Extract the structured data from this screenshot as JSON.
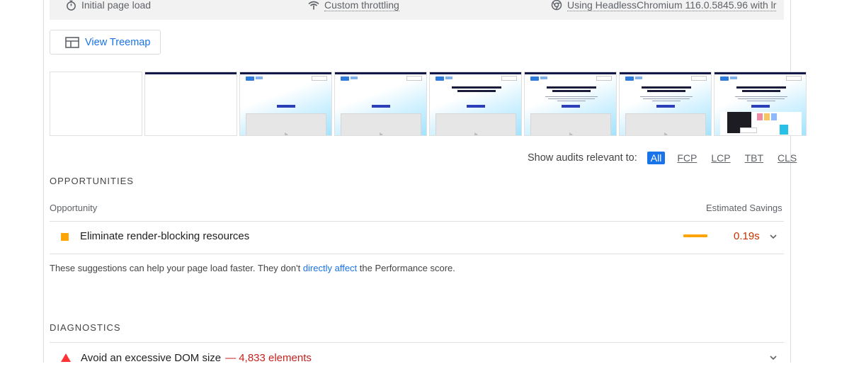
{
  "meta": {
    "initial_load": "Initial page load",
    "throttling": "Custom throttling",
    "browser": "Using HeadlessChromium 116.0.5845.96 with lr"
  },
  "treemap": {
    "label": "View Treemap"
  },
  "filmstrip": {
    "frame_count": 8
  },
  "filter": {
    "label": "Show audits relevant to:",
    "chips": [
      "All",
      "FCP",
      "LCP",
      "TBT",
      "CLS"
    ],
    "active": "All"
  },
  "opportunities": {
    "heading": "OPPORTUNITIES",
    "col_left": "Opportunity",
    "col_right": "Estimated Savings",
    "items": [
      {
        "title": "Eliminate render-blocking resources",
        "savings": "0.19s",
        "color": "#ffa400"
      }
    ],
    "note_before": "These suggestions can help your page load faster. They don't ",
    "note_link": "directly affect",
    "note_after": " the Performance score."
  },
  "diagnostics": {
    "heading": "DIAGNOSTICS",
    "items": [
      {
        "title": "Avoid an excessive DOM size",
        "detail": "— 4,833 elements",
        "color": "#ff3333"
      }
    ]
  },
  "colors": {
    "accent": "#1a73e8",
    "average": "#ffa400",
    "fail": "#ff3333",
    "savings": "#c33300"
  }
}
